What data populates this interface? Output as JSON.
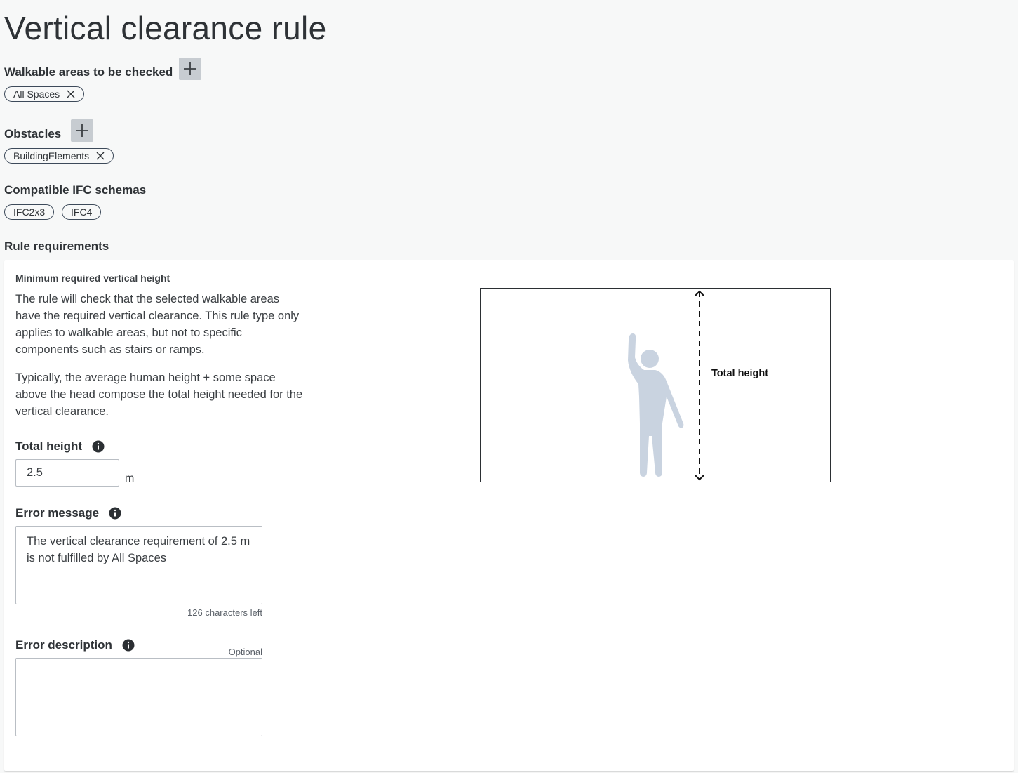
{
  "page": {
    "title": "Vertical clearance rule"
  },
  "walkable": {
    "label": "Walkable areas to be checked",
    "chips": [
      "All Spaces"
    ]
  },
  "obstacles": {
    "label": "Obstacles",
    "chips": [
      "BuildingElements"
    ]
  },
  "schemas": {
    "label": "Compatible IFC schemas",
    "chips": [
      "IFC2x3",
      "IFC4"
    ]
  },
  "requirements": {
    "label": "Rule requirements",
    "card_title": "Minimum required vertical height",
    "description_1": "The rule will check that the selected walkable areas have the required vertical clearance. This rule type only applies to walkable areas, but not to specific components such as stairs or ramps.",
    "description_2": "Typically, the average human height + some space above the head compose the total height needed for the vertical clearance.",
    "total_height": {
      "label": "Total height",
      "value": "2.5",
      "unit": "m"
    },
    "error_message": {
      "label": "Error message",
      "value": "The vertical clearance requirement of 2.5 m is not fulfilled by All Spaces",
      "chars_left": "126 characters left"
    },
    "error_description": {
      "label": "Error description",
      "optional": "Optional",
      "value": ""
    },
    "diagram": {
      "label": "Total height"
    }
  },
  "colors": {
    "add_button": "#c7ccd1",
    "chip_border": "#3d4a5a",
    "figure": "#c9d3e0",
    "background": "#f7f8f8"
  },
  "icons": [
    "plus-icon",
    "close-icon",
    "info-icon",
    "person-icon",
    "arrow-up-icon",
    "arrow-down-icon"
  ]
}
